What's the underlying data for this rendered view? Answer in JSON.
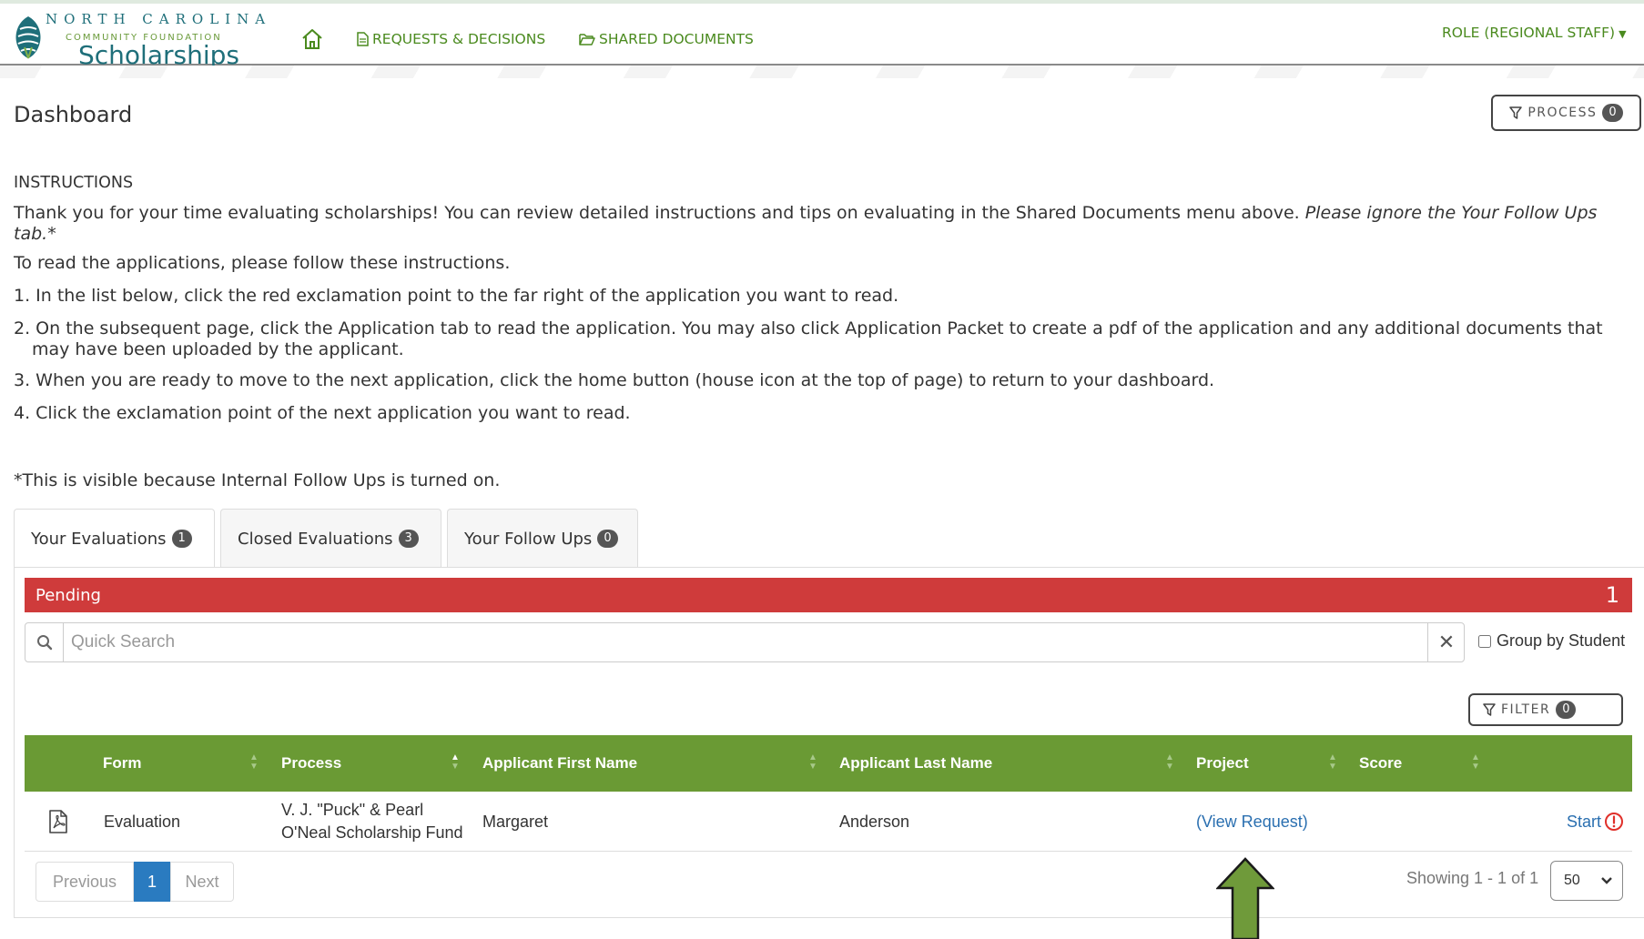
{
  "brand": {
    "line1": "NORTH CAROLINA",
    "line2": "COMMUNITY FOUNDATION",
    "line3": "Scholarships",
    "colors": {
      "primary": "#1f6f7a",
      "accent": "#6a9a3a"
    }
  },
  "nav": {
    "home_icon": "home-icon",
    "requests_label": "REQUESTS & DECISIONS",
    "shared_label": "SHARED DOCUMENTS",
    "role_label": "ROLE (REGIONAL STAFF)",
    "color": "#4a8a1e"
  },
  "header": {
    "title": "Dashboard",
    "process_label": "PROCESS",
    "process_count": "0"
  },
  "instructions": {
    "heading": "INSTRUCTIONS",
    "intro": "Thank you for your time evaluating scholarships! You can review detailed instructions and tips on evaluating in the Shared Documents menu above.",
    "intro_italic": "Please ignore the Your Follow Ups tab.*",
    "lead": "To read the applications, please follow these instructions.",
    "steps": [
      "1. In the list below, click the red exclamation point to the far right of the application you want to read.",
      "2. On the subsequent page, click the Application tab to read the application. You may also click Application Packet to create a pdf of the application and any additional documents that may have been uploaded by the applicant.",
      "3. When you are ready to move to the next application, click the home button (house icon at the top of page) to return to your dashboard.",
      "4. Click the exclamation point of the next application you want to read."
    ],
    "footnote": "*This is visible because Internal Follow Ups is turned on."
  },
  "tabs": [
    {
      "label": "Your Evaluations",
      "count": "1",
      "active": true
    },
    {
      "label": "Closed Evaluations",
      "count": "3",
      "active": false
    },
    {
      "label": "Your Follow Ups",
      "count": "0",
      "active": false
    }
  ],
  "pending": {
    "label": "Pending",
    "count": "1",
    "color": "#cf3b3b"
  },
  "search": {
    "placeholder": "Quick Search",
    "value": "",
    "group_by_label": "Group by Student",
    "group_by_checked": false
  },
  "filter": {
    "label": "FILTER",
    "count": "0"
  },
  "table": {
    "header_color": "#6a9a34",
    "columns": [
      "Form",
      "Process",
      "Applicant First Name",
      "Applicant Last Name",
      "Project",
      "Score"
    ],
    "rows": [
      {
        "icon": "pdf-file-icon",
        "form": "Evaluation",
        "process_line1": "V. J. \"Puck\" & Pearl",
        "process_line2": "O'Neal Scholarship Fund",
        "first_name": "Margaret",
        "last_name": "Anderson",
        "project": "(View Request)",
        "score": "",
        "action": "Start",
        "action_icon": "exclamation-circle-icon"
      }
    ]
  },
  "pagination": {
    "previous": "Previous",
    "current": "1",
    "next": "Next",
    "showing": "Showing 1 - 1 of 1",
    "page_size": "50"
  },
  "annotation": {
    "arrow_color": "#6f9a3a"
  }
}
